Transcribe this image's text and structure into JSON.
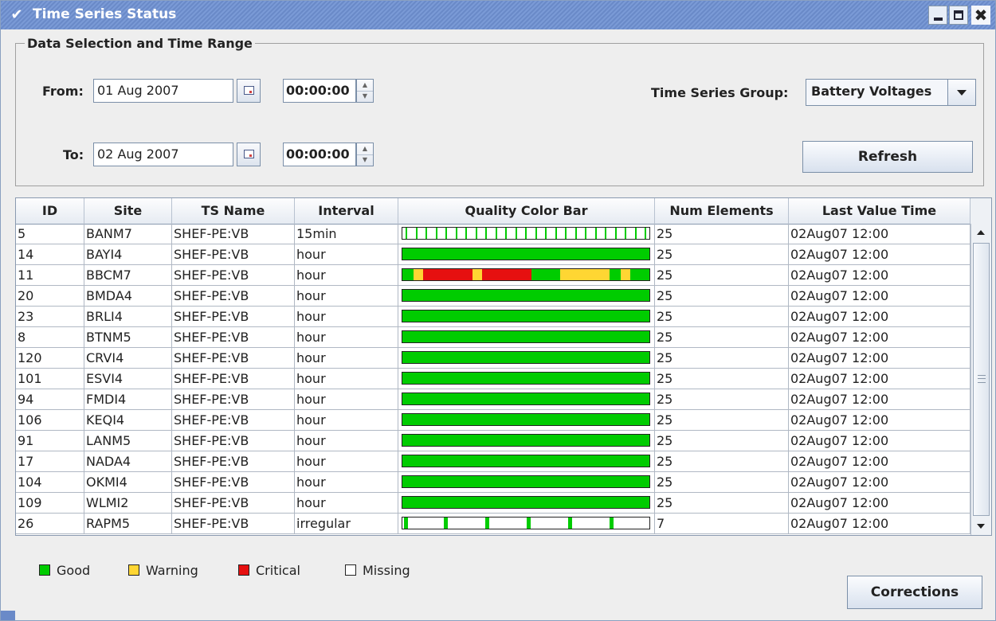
{
  "window": {
    "title": "Time Series Status"
  },
  "selection": {
    "legend": "Data Selection and Time Range",
    "from_label": "From:",
    "from_date": "01 Aug 2007",
    "from_time": "00:00:00",
    "to_label": "To:",
    "to_date": "02 Aug 2007",
    "to_time": "00:00:00",
    "group_label": "Time Series Group:",
    "group_value": "Battery Voltages",
    "refresh_label": "Refresh"
  },
  "table": {
    "columns": [
      "ID",
      "Site",
      "TS Name",
      "Interval",
      "Quality Color Bar",
      "Num Elements",
      "Last Value Time"
    ],
    "rows": [
      {
        "id": "5",
        "site": "BANM7",
        "ts_name": "SHEF-PE:VB",
        "interval": "15min",
        "num_elements": "25",
        "last_value_time": "02Aug07 12:00",
        "quality": "ticks"
      },
      {
        "id": "14",
        "site": "BAYI4",
        "ts_name": "SHEF-PE:VB",
        "interval": "hour",
        "num_elements": "25",
        "last_value_time": "02Aug07 12:00",
        "quality": "good"
      },
      {
        "id": "11",
        "site": "BBCM7",
        "ts_name": "SHEF-PE:VB",
        "interval": "hour",
        "num_elements": "25",
        "last_value_time": "02Aug07 12:00",
        "quality": "mixed"
      },
      {
        "id": "20",
        "site": "BMDA4",
        "ts_name": "SHEF-PE:VB",
        "interval": "hour",
        "num_elements": "25",
        "last_value_time": "02Aug07 12:00",
        "quality": "good"
      },
      {
        "id": "23",
        "site": "BRLI4",
        "ts_name": "SHEF-PE:VB",
        "interval": "hour",
        "num_elements": "25",
        "last_value_time": "02Aug07 12:00",
        "quality": "good"
      },
      {
        "id": "8",
        "site": "BTNM5",
        "ts_name": "SHEF-PE:VB",
        "interval": "hour",
        "num_elements": "25",
        "last_value_time": "02Aug07 12:00",
        "quality": "good"
      },
      {
        "id": "120",
        "site": "CRVI4",
        "ts_name": "SHEF-PE:VB",
        "interval": "hour",
        "num_elements": "25",
        "last_value_time": "02Aug07 12:00",
        "quality": "good"
      },
      {
        "id": "101",
        "site": "ESVI4",
        "ts_name": "SHEF-PE:VB",
        "interval": "hour",
        "num_elements": "25",
        "last_value_time": "02Aug07 12:00",
        "quality": "good"
      },
      {
        "id": "94",
        "site": "FMDI4",
        "ts_name": "SHEF-PE:VB",
        "interval": "hour",
        "num_elements": "25",
        "last_value_time": "02Aug07 12:00",
        "quality": "good"
      },
      {
        "id": "106",
        "site": "KEQI4",
        "ts_name": "SHEF-PE:VB",
        "interval": "hour",
        "num_elements": "25",
        "last_value_time": "02Aug07 12:00",
        "quality": "good"
      },
      {
        "id": "91",
        "site": "LANM5",
        "ts_name": "SHEF-PE:VB",
        "interval": "hour",
        "num_elements": "25",
        "last_value_time": "02Aug07 12:00",
        "quality": "good"
      },
      {
        "id": "17",
        "site": "NADA4",
        "ts_name": "SHEF-PE:VB",
        "interval": "hour",
        "num_elements": "25",
        "last_value_time": "02Aug07 12:00",
        "quality": "good"
      },
      {
        "id": "104",
        "site": "OKMI4",
        "ts_name": "SHEF-PE:VB",
        "interval": "hour",
        "num_elements": "25",
        "last_value_time": "02Aug07 12:00",
        "quality": "good"
      },
      {
        "id": "109",
        "site": "WLMI2",
        "ts_name": "SHEF-PE:VB",
        "interval": "hour",
        "num_elements": "25",
        "last_value_time": "02Aug07 12:00",
        "quality": "good"
      },
      {
        "id": "26",
        "site": "RAPM5",
        "ts_name": "SHEF-PE:VB",
        "interval": "irregular",
        "num_elements": "7",
        "last_value_time": "02Aug07 12:00",
        "quality": "sparse"
      }
    ]
  },
  "legend": [
    {
      "label": "Good",
      "color": "#00cc00"
    },
    {
      "label": "Warning",
      "color": "#ffd633"
    },
    {
      "label": "Critical",
      "color": "#e61010"
    },
    {
      "label": "Missing",
      "color": "#ffffff"
    }
  ],
  "corrections_label": "Corrections",
  "colors": {
    "good": "#00cc00",
    "warning": "#ffd633",
    "critical": "#e61010",
    "missing": "#ffffff",
    "titlebar": "#6a8ac8"
  }
}
